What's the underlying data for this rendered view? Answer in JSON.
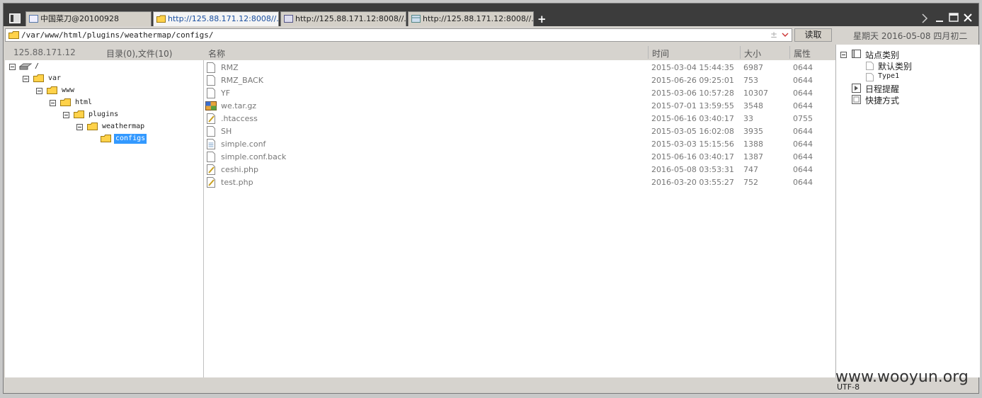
{
  "tabs": [
    {
      "label": "中国菜刀@20100928"
    },
    {
      "label": "http://125.88.171.12:8008//..."
    },
    {
      "label": "http://125.88.171.12:8008//..."
    },
    {
      "label": "http://125.88.171.12:8008//..."
    }
  ],
  "new_tab": "+",
  "address": {
    "path": "/var/www/html/plugins/weathermap/configs/",
    "read_label": "读取"
  },
  "date_text": "星期天 2016-05-08 四月初二",
  "left_header": {
    "host": "125.88.171.12",
    "summary": "目录(0),文件(10)"
  },
  "columns": {
    "name": "名称",
    "time": "时间",
    "size": "大小",
    "attr": "属性"
  },
  "tree": {
    "root": "/",
    "nodes": [
      "var",
      "www",
      "html",
      "plugins",
      "weathermap",
      "configs"
    ]
  },
  "files": [
    {
      "name": "RMZ",
      "time": "2015-03-04 15:44:35",
      "size": "6987",
      "attr": "0644",
      "icon": "blank-file-icon"
    },
    {
      "name": "RMZ_BACK",
      "time": "2015-06-26 09:25:01",
      "size": "753",
      "attr": "0644",
      "icon": "blank-file-icon"
    },
    {
      "name": "YF",
      "time": "2015-03-06 10:57:28",
      "size": "10307",
      "attr": "0644",
      "icon": "blank-file-icon"
    },
    {
      "name": "we.tar.gz",
      "time": "2015-07-01 13:59:55",
      "size": "3548",
      "attr": "0644",
      "icon": "archive-icon"
    },
    {
      "name": ".htaccess",
      "time": "2015-06-16 03:40:17",
      "size": "33",
      "attr": "0755",
      "icon": "script-file-icon"
    },
    {
      "name": "SH",
      "time": "2015-03-05 16:02:08",
      "size": "3935",
      "attr": "0644",
      "icon": "blank-file-icon"
    },
    {
      "name": "simple.conf",
      "time": "2015-03-03 15:15:56",
      "size": "1388",
      "attr": "0644",
      "icon": "config-file-icon"
    },
    {
      "name": "simple.conf.back",
      "time": "2015-06-16 03:40:17",
      "size": "1387",
      "attr": "0644",
      "icon": "blank-file-icon"
    },
    {
      "name": "ceshi.php",
      "time": "2016-05-08 03:53:31",
      "size": "747",
      "attr": "0644",
      "icon": "script-file-icon"
    },
    {
      "name": "test.php",
      "time": "2016-03-20 03:55:27",
      "size": "752",
      "attr": "0644",
      "icon": "script-file-icon"
    }
  ],
  "right_panel": {
    "site_category": "站点类别",
    "default_category": "默认类别",
    "type1": "Type1",
    "schedule": "日程提醒",
    "shortcuts": "快捷方式"
  },
  "status": {
    "encoding": "UTF-8"
  },
  "watermark": "www.wooyun.org",
  "colors": {
    "selection": "#3399ff",
    "tab_text_active": "#1a4fa0"
  }
}
